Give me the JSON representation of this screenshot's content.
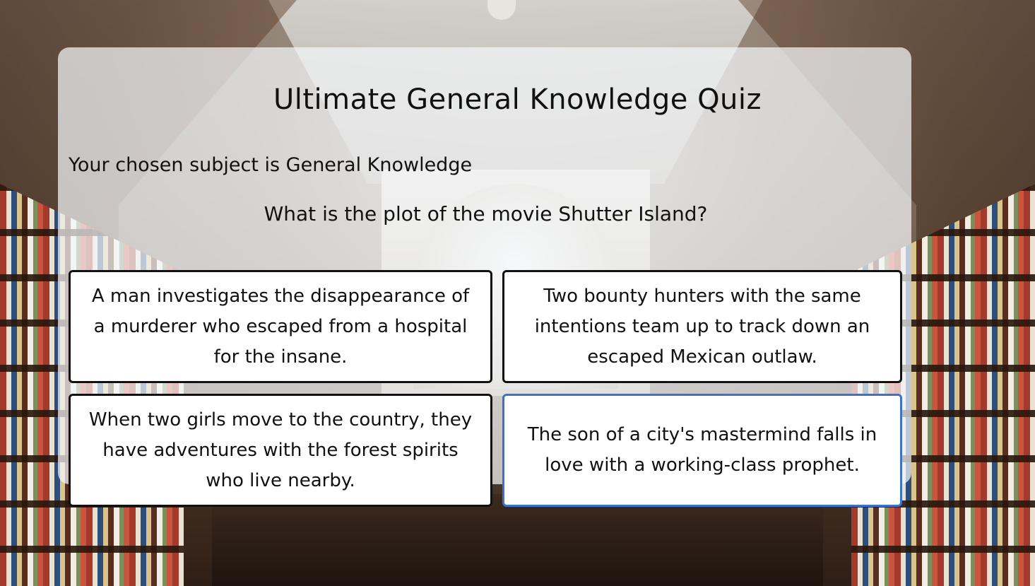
{
  "quiz": {
    "title": "Ultimate General Knowledge Quiz",
    "subject_text": "Your chosen subject is General Knowledge",
    "question": "What is the plot of the movie Shutter Island?",
    "answers": [
      {
        "label": "A man investigates the disappearance of a murderer who escaped from a hospital for the insane."
      },
      {
        "label": "Two bounty hunters with the same intentions team up to track down an escaped Mexican outlaw."
      },
      {
        "label": "When two girls move to the country, they have adventures with the forest spirits who live nearby."
      },
      {
        "label": "The son of a city's mastermind falls in love with a working-class prophet."
      }
    ],
    "selected_answer_index": 3
  },
  "colors": {
    "panel_background": "#f4f6f9",
    "answer_border": "#111111",
    "selected_border": "#3a73c9",
    "text": "#111111"
  }
}
